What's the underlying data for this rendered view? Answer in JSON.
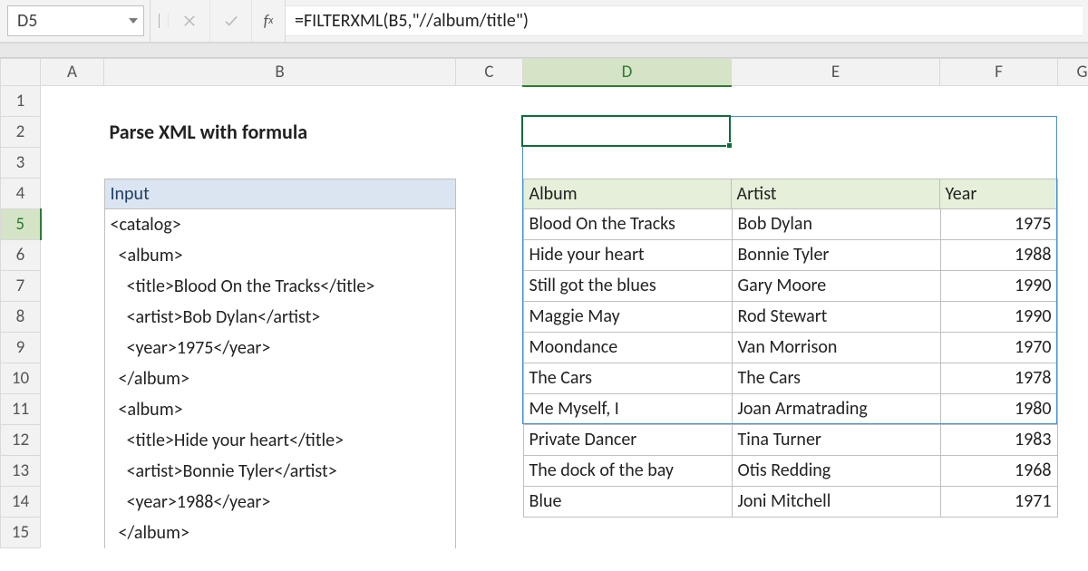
{
  "formula_bar": {
    "cell_ref": "D5",
    "formula": "=FILTERXML(B5,\"//album/title\")"
  },
  "columns": [
    "",
    "A",
    "B",
    "C",
    "D",
    "E",
    "F",
    "G"
  ],
  "rows": [
    "1",
    "2",
    "3",
    "4",
    "5",
    "6",
    "7",
    "8",
    "9",
    "10",
    "11",
    "12",
    "13",
    "14",
    "15"
  ],
  "title": "Parse XML with formula",
  "input_header": "Input",
  "input_lines": [
    "<catalog>",
    "  <album>",
    "    <title>Blood On the Tracks</title>",
    "    <artist>Bob Dylan</artist>",
    "    <year>1975</year>",
    "  </album>",
    "  <album>",
    "    <title>Hide your heart</title>",
    "    <artist>Bonnie Tyler</artist>",
    "    <year>1988</year>",
    "  </album>"
  ],
  "output_headers": {
    "album": "Album",
    "artist": "Artist",
    "year": "Year"
  },
  "output_rows": [
    {
      "album": "Blood On the Tracks",
      "artist": "Bob Dylan",
      "year": "1975"
    },
    {
      "album": "Hide your heart",
      "artist": "Bonnie Tyler",
      "year": "1988"
    },
    {
      "album": "Still got the blues",
      "artist": "Gary Moore",
      "year": "1990"
    },
    {
      "album": "Maggie May",
      "artist": "Rod Stewart",
      "year": "1990"
    },
    {
      "album": "Moondance",
      "artist": "Van Morrison",
      "year": "1970"
    },
    {
      "album": "The Cars",
      "artist": "The Cars",
      "year": "1978"
    },
    {
      "album": "Me Myself, I",
      "artist": "Joan Armatrading",
      "year": "1980"
    },
    {
      "album": "Private Dancer",
      "artist": "Tina Turner",
      "year": "1983"
    },
    {
      "album": "The dock of the bay",
      "artist": "Otis Redding",
      "year": "1968"
    },
    {
      "album": "Blue",
      "artist": "Joni Mitchell",
      "year": "1971"
    }
  ],
  "active": {
    "col": "D",
    "row": "5"
  }
}
